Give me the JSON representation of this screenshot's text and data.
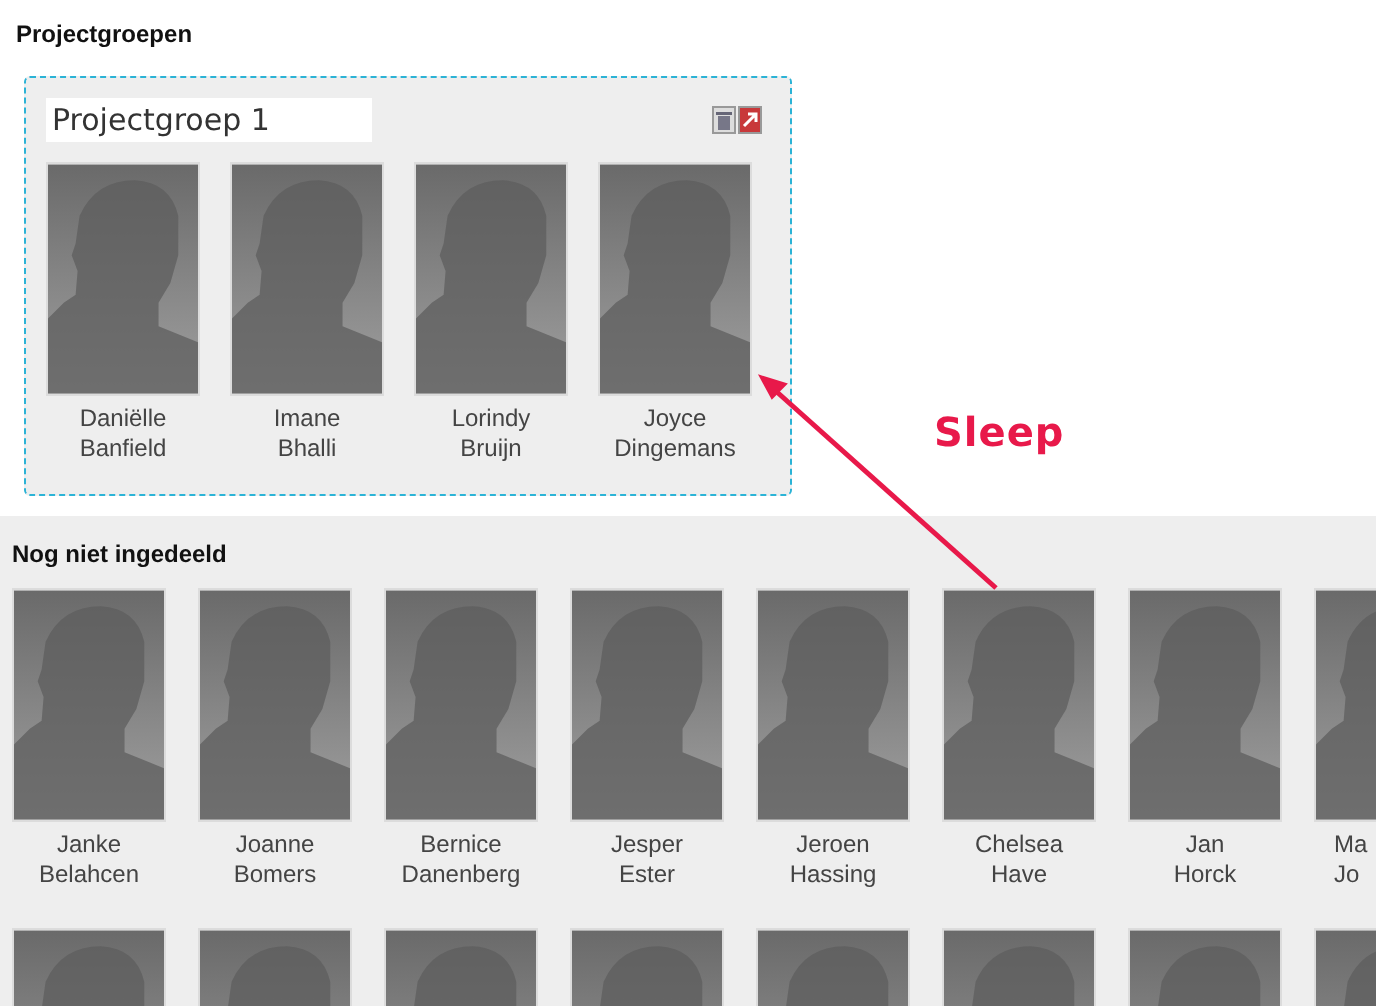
{
  "heading": "Projectgroepen",
  "group": {
    "name": "Projectgroep 1",
    "members": [
      {
        "first": "Daniëlle",
        "last": "Banfield"
      },
      {
        "first": "Imane",
        "last": "Bhalli"
      },
      {
        "first": "Lorindy",
        "last": "Bruijn"
      },
      {
        "first": "Joyce",
        "last": "Dingemans"
      }
    ]
  },
  "annotation": {
    "label": "Sleep"
  },
  "unassigned": {
    "title": "Nog niet ingedeeld",
    "students": [
      {
        "kind": "full",
        "first": "Janke",
        "last": "Belahcen"
      },
      {
        "kind": "full",
        "first": "Joanne",
        "last": "Bomers"
      },
      {
        "kind": "full",
        "first": "Bernice",
        "last": "Danenberg"
      },
      {
        "kind": "full",
        "first": "Jesper",
        "last": "Ester"
      },
      {
        "kind": "full",
        "first": "Jeroen",
        "last": "Hassing"
      },
      {
        "kind": "full",
        "first": "Chelsea",
        "last": "Have"
      },
      {
        "kind": "full",
        "first": "Jan",
        "last": "Horck"
      },
      {
        "kind": "cut",
        "first": "Ma",
        "last": "Jo"
      }
    ],
    "next_row": [
      {
        "kind": "avatar"
      },
      {
        "kind": "avatar"
      },
      {
        "kind": "avatar"
      },
      {
        "kind": "avatar"
      },
      {
        "kind": "avatar"
      },
      {
        "kind": "avatar"
      },
      {
        "kind": "avatar"
      },
      {
        "kind": "avatar"
      }
    ]
  }
}
